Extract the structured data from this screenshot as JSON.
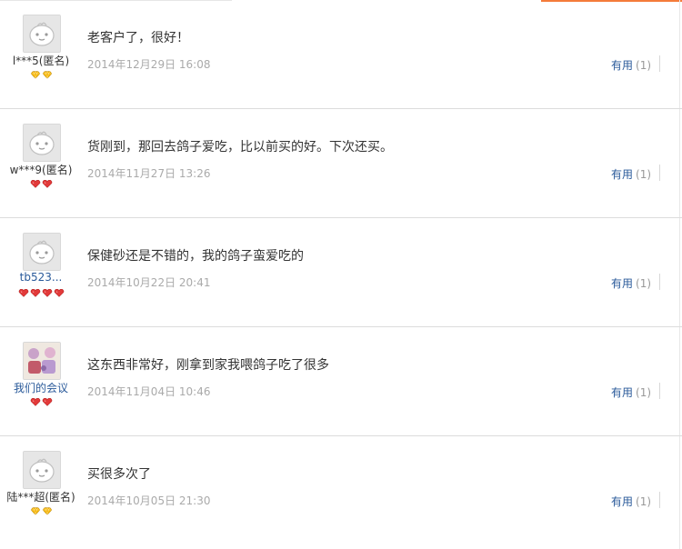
{
  "useful_label": "有用",
  "reviews": [
    {
      "user": "l***5(匿名)",
      "badge": "gold",
      "badge_count": 2,
      "text": "老客户了，很好！",
      "date": "2014年12月29日 16:08",
      "useful_count": "(1)"
    },
    {
      "user": "w***9(匿名)",
      "badge": "red",
      "badge_count": 2,
      "text": "货刚到，那回去鸽子爱吃，比以前买的好。下次还买。",
      "date": "2014年11月27日 13:26",
      "useful_count": "(1)"
    },
    {
      "user": "tb523...",
      "badge": "red",
      "badge_count": 4,
      "text": "保健砂还是不错的，我的鸽子蛮爱吃的",
      "date": "2014年10月22日 20:41",
      "useful_count": "(1)"
    },
    {
      "user": "我们的会议",
      "badge": "red",
      "badge_count": 2,
      "text": "这东西非常好，刚拿到家我喂鸽子吃了很多",
      "date": "2014年11月04日 10:46",
      "useful_count": "(1)"
    },
    {
      "user": "陆***超(匿名)",
      "badge": "gold",
      "badge_count": 2,
      "text": "买很多次了",
      "date": "2014年10月05日 21:30",
      "useful_count": "(1)"
    }
  ],
  "colors": {
    "gold_badge": "#f5b400",
    "red_badge": "#e23a3a",
    "link": "#2a5a9a",
    "accent": "#f47b3a"
  }
}
